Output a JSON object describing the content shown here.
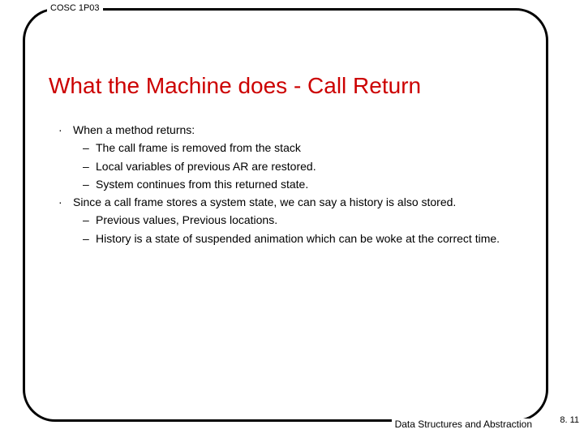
{
  "course": "COSC 1P03",
  "title": "What the Machine does - Call Return",
  "bullets": [
    {
      "text": "When a method returns:",
      "subs": [
        "The call frame is removed from the stack",
        "Local variables of previous AR are restored.",
        "System continues from this returned state."
      ]
    },
    {
      "text": "Since a call frame stores a system state, we can say a history is also stored.",
      "subs": [
        "Previous values, Previous locations.",
        "History is a state of suspended animation which can be woke at the correct time."
      ]
    }
  ],
  "footer": "Data Structures and Abstraction",
  "page": "8. 11",
  "markers": {
    "bullet": "·",
    "dash": "–"
  }
}
